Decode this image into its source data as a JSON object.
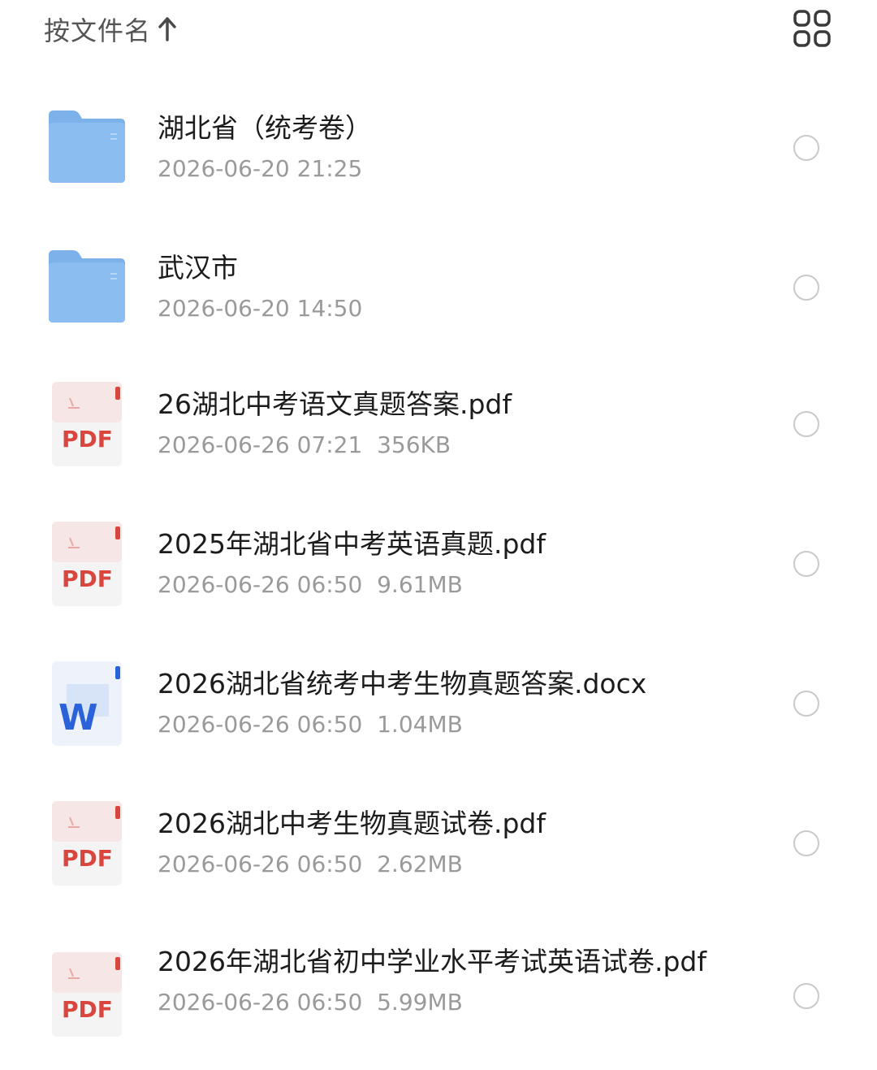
{
  "toolbar": {
    "sort_label": "按文件名",
    "sort_icon": "arrow-up-icon",
    "view_toggle_icon": "grid-view-icon"
  },
  "files": [
    {
      "name": "湖北省（统考卷）",
      "meta": "2026-06-20 21:25",
      "type": "folder"
    },
    {
      "name": "武汉市",
      "meta": "2026-06-20 14:50",
      "type": "folder"
    },
    {
      "name": "26湖北中考语文真题答案.pdf",
      "meta": "2026-06-26 07:21  356KB",
      "type": "pdf",
      "badge": "PDF"
    },
    {
      "name": "2025年湖北省中考英语真题.pdf",
      "meta": "2026-06-26 06:50  9.61MB",
      "type": "pdf",
      "badge": "PDF"
    },
    {
      "name": "2026湖北省统考中考生物真题答案.docx",
      "meta": "2026-06-26 06:50  1.04MB",
      "type": "word",
      "badge": "W"
    },
    {
      "name": "2026湖北中考生物真题试卷.pdf",
      "meta": "2026-06-26 06:50  2.62MB",
      "type": "pdf",
      "badge": "PDF"
    },
    {
      "name": "2026年湖北省初中学业水平考试英语试卷.pdf",
      "meta": "2026-06-26 06:50  5.99MB",
      "type": "pdf",
      "badge": "PDF"
    }
  ],
  "colors": {
    "folder": "#7fb3ec",
    "pdf_red": "#d9463e",
    "word_blue": "#2b62d9",
    "meta_gray": "#9a9a9a"
  }
}
